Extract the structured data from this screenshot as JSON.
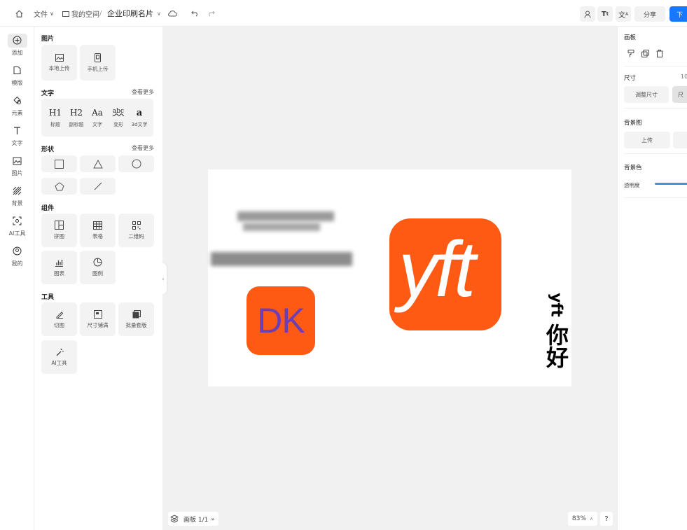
{
  "topbar": {
    "file_menu": "文件",
    "my_space": "我的空间",
    "separator": "/",
    "doc_title": "企业印刷名片",
    "share": "分享",
    "download": "下"
  },
  "rail": {
    "items": [
      {
        "label": "添加",
        "icon": "plus-circle-icon"
      },
      {
        "label": "模版",
        "icon": "template-icon"
      },
      {
        "label": "元素",
        "icon": "shapes-icon"
      },
      {
        "label": "文字",
        "icon": "text-icon"
      },
      {
        "label": "图片",
        "icon": "image-icon"
      },
      {
        "label": "背景",
        "icon": "background-icon"
      },
      {
        "label": "AI工具",
        "icon": "ai-icon"
      },
      {
        "label": "我的",
        "icon": "user-icon"
      }
    ]
  },
  "panel": {
    "image_section": {
      "title": "图片",
      "items": [
        {
          "label": "本地上传",
          "icon": "local-upload-icon"
        },
        {
          "label": "手机上传",
          "icon": "phone-upload-icon"
        }
      ]
    },
    "text_section": {
      "title": "文字",
      "see_more": "查看更多",
      "items": [
        {
          "glyph": "H1",
          "label": "标题"
        },
        {
          "glyph": "H2",
          "label": "副标题"
        },
        {
          "glyph": "Aa",
          "label": "文字"
        },
        {
          "glyph": "abc",
          "label": "变形"
        },
        {
          "glyph": "a",
          "label": "3d文字"
        }
      ]
    },
    "shape_section": {
      "title": "形状",
      "see_more": "查看更多",
      "items": [
        "rectangle-shape",
        "triangle-shape",
        "circle-shape",
        "pentagon-shape",
        "line-shape"
      ]
    },
    "component_section": {
      "title": "组件",
      "items": [
        {
          "label": "拼图",
          "icon": "puzzle-layout-icon"
        },
        {
          "label": "表格",
          "icon": "table-icon"
        },
        {
          "label": "二维码",
          "icon": "qrcode-icon"
        },
        {
          "label": "图表",
          "icon": "chart-icon"
        },
        {
          "label": "图例",
          "icon": "legend-icon"
        }
      ]
    },
    "tool_section": {
      "title": "工具",
      "items": [
        {
          "label": "切图",
          "icon": "slice-icon"
        },
        {
          "label": "尺寸铺满",
          "icon": "fit-size-icon"
        },
        {
          "label": "批量套版",
          "icon": "batch-icon"
        },
        {
          "label": "AI工具",
          "icon": "magic-wand-icon"
        }
      ]
    }
  },
  "canvas": {
    "logo_dk": "DK",
    "logo_yft": "yft",
    "vertical_text": "你好",
    "vertical_latin": "yft",
    "colors": {
      "orange": "#ff5a14",
      "dk_text": "#6d3fb0",
      "accent": "#1677ff"
    }
  },
  "bottom": {
    "page_label": "画板 1/1",
    "zoom": "83%",
    "help": "?"
  },
  "rpanel": {
    "board_title": "画板",
    "size_title": "尺寸",
    "size_value": "10",
    "adjust_size": "调整尺寸",
    "size_btn2": "尺",
    "bg_image_title": "背景图",
    "upload": "上传",
    "bg_color_title": "背景色",
    "opacity": "透明度"
  }
}
